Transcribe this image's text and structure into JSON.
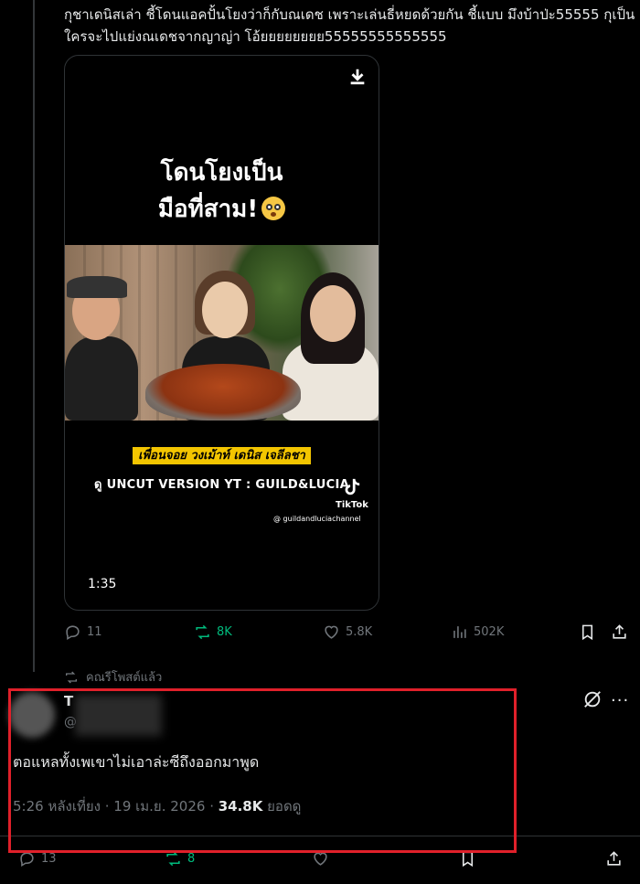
{
  "post": {
    "text": "กุชาเดนิสเล่า ชี้โดนแอคปั้นโยงว่าก็กับณเดช เพราะเล่นธี่หยดด้วยกัน ชี้แบบ มึงบ้าป่ะ55555 กุเป็นใครจะไปแย่งณเดชจากญาญ่า โอ้ยยยยยยยย55555555555555"
  },
  "video": {
    "overlay_line1": "โดนโยงเป็น",
    "overlay_line2": "มือที่สาม!",
    "caption_yellow": "เพื่อนจอย วงเม้าท์ เดนิส เจลีลชา",
    "caption_uncut": "ดู UNCUT VERSION YT : GUILD&LUCIA",
    "tiktok_name": "TikTok",
    "tiktok_handle": "@ guildandluciachannel",
    "duration": "1:35"
  },
  "actions": {
    "replies": "11",
    "reposts": "8K",
    "likes": "5.8K",
    "views": "502K"
  },
  "repost_label": "คณรีโพสต์แล้ว",
  "reply": {
    "name": "T",
    "handle": "@",
    "text": "ตอแหลทั้งเพเขาไม่เอาล่ะซีถึงออกมาพูด",
    "time": "5:26 หลังเที่ยง · 19 เม.ย. 2026 · ",
    "views_count": "34.8K",
    "views_label": " ยอดดู"
  },
  "bottom_actions": {
    "replies": "13",
    "reposts": "8"
  },
  "colors": {
    "background": "#000000",
    "muted": "#71767b",
    "repost_green": "#00ba7c",
    "highlight_box": "#e0202a",
    "caption_yellow": "#f3c500"
  }
}
